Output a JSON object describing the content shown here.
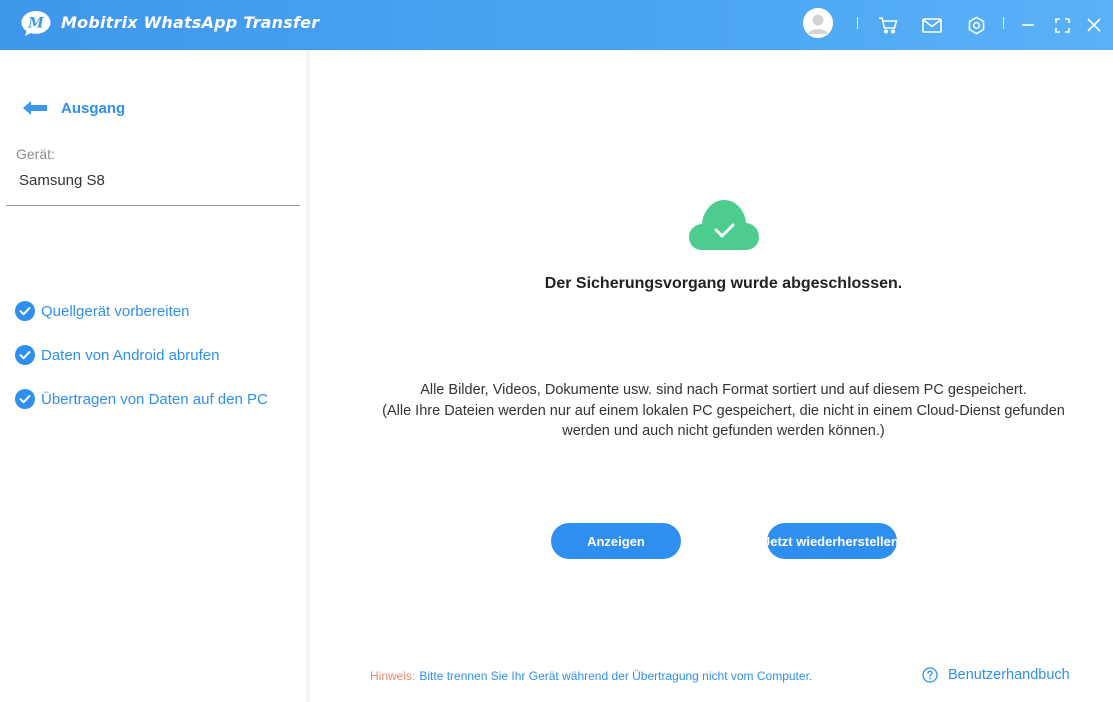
{
  "app": {
    "title": "Mobitrix WhatsApp Transfer",
    "logo_letter": "M",
    "accent_color": "#2f8ff0"
  },
  "titlebar": {
    "icons": [
      "user-avatar-icon",
      "cart-icon",
      "mail-icon",
      "settings-icon",
      "minimize-icon",
      "maximize-icon",
      "close-icon"
    ]
  },
  "sidebar": {
    "back_label": "Ausgang",
    "device_label": "Gerät:",
    "device_name": "Samsung S8",
    "steps": [
      {
        "label": "Quellgerät vorbereiten",
        "done": true
      },
      {
        "label": "Daten von Android abrufen",
        "done": true
      },
      {
        "label": "Übertragen von Daten auf den PC",
        "done": true
      }
    ]
  },
  "main": {
    "status_title": "Der Sicherungsvorgang wurde abgeschlossen.",
    "description": [
      "Alle Bilder, Videos, Dokumente usw. sind nach Format sortiert und auf diesem PC gespeichert.",
      "(Alle Ihre Dateien werden nur auf einem lokalen PC gespeichert, die nicht in einem Cloud-Dienst gefunden",
      "werden und auch nicht gefunden werden können.)"
    ],
    "buttons": {
      "view_label": "Anzeigen",
      "restore_label": "Jetzt wiederherstellen"
    },
    "success_color": "#4ccc8f"
  },
  "footer": {
    "hint_label": "Hinweis:",
    "hint_text": "Bitte trennen Sie Ihr Gerät während der Übertragung nicht vom Computer.",
    "manual_label": "Benutzerhandbuch",
    "hint_label_color": "#e8896a"
  }
}
